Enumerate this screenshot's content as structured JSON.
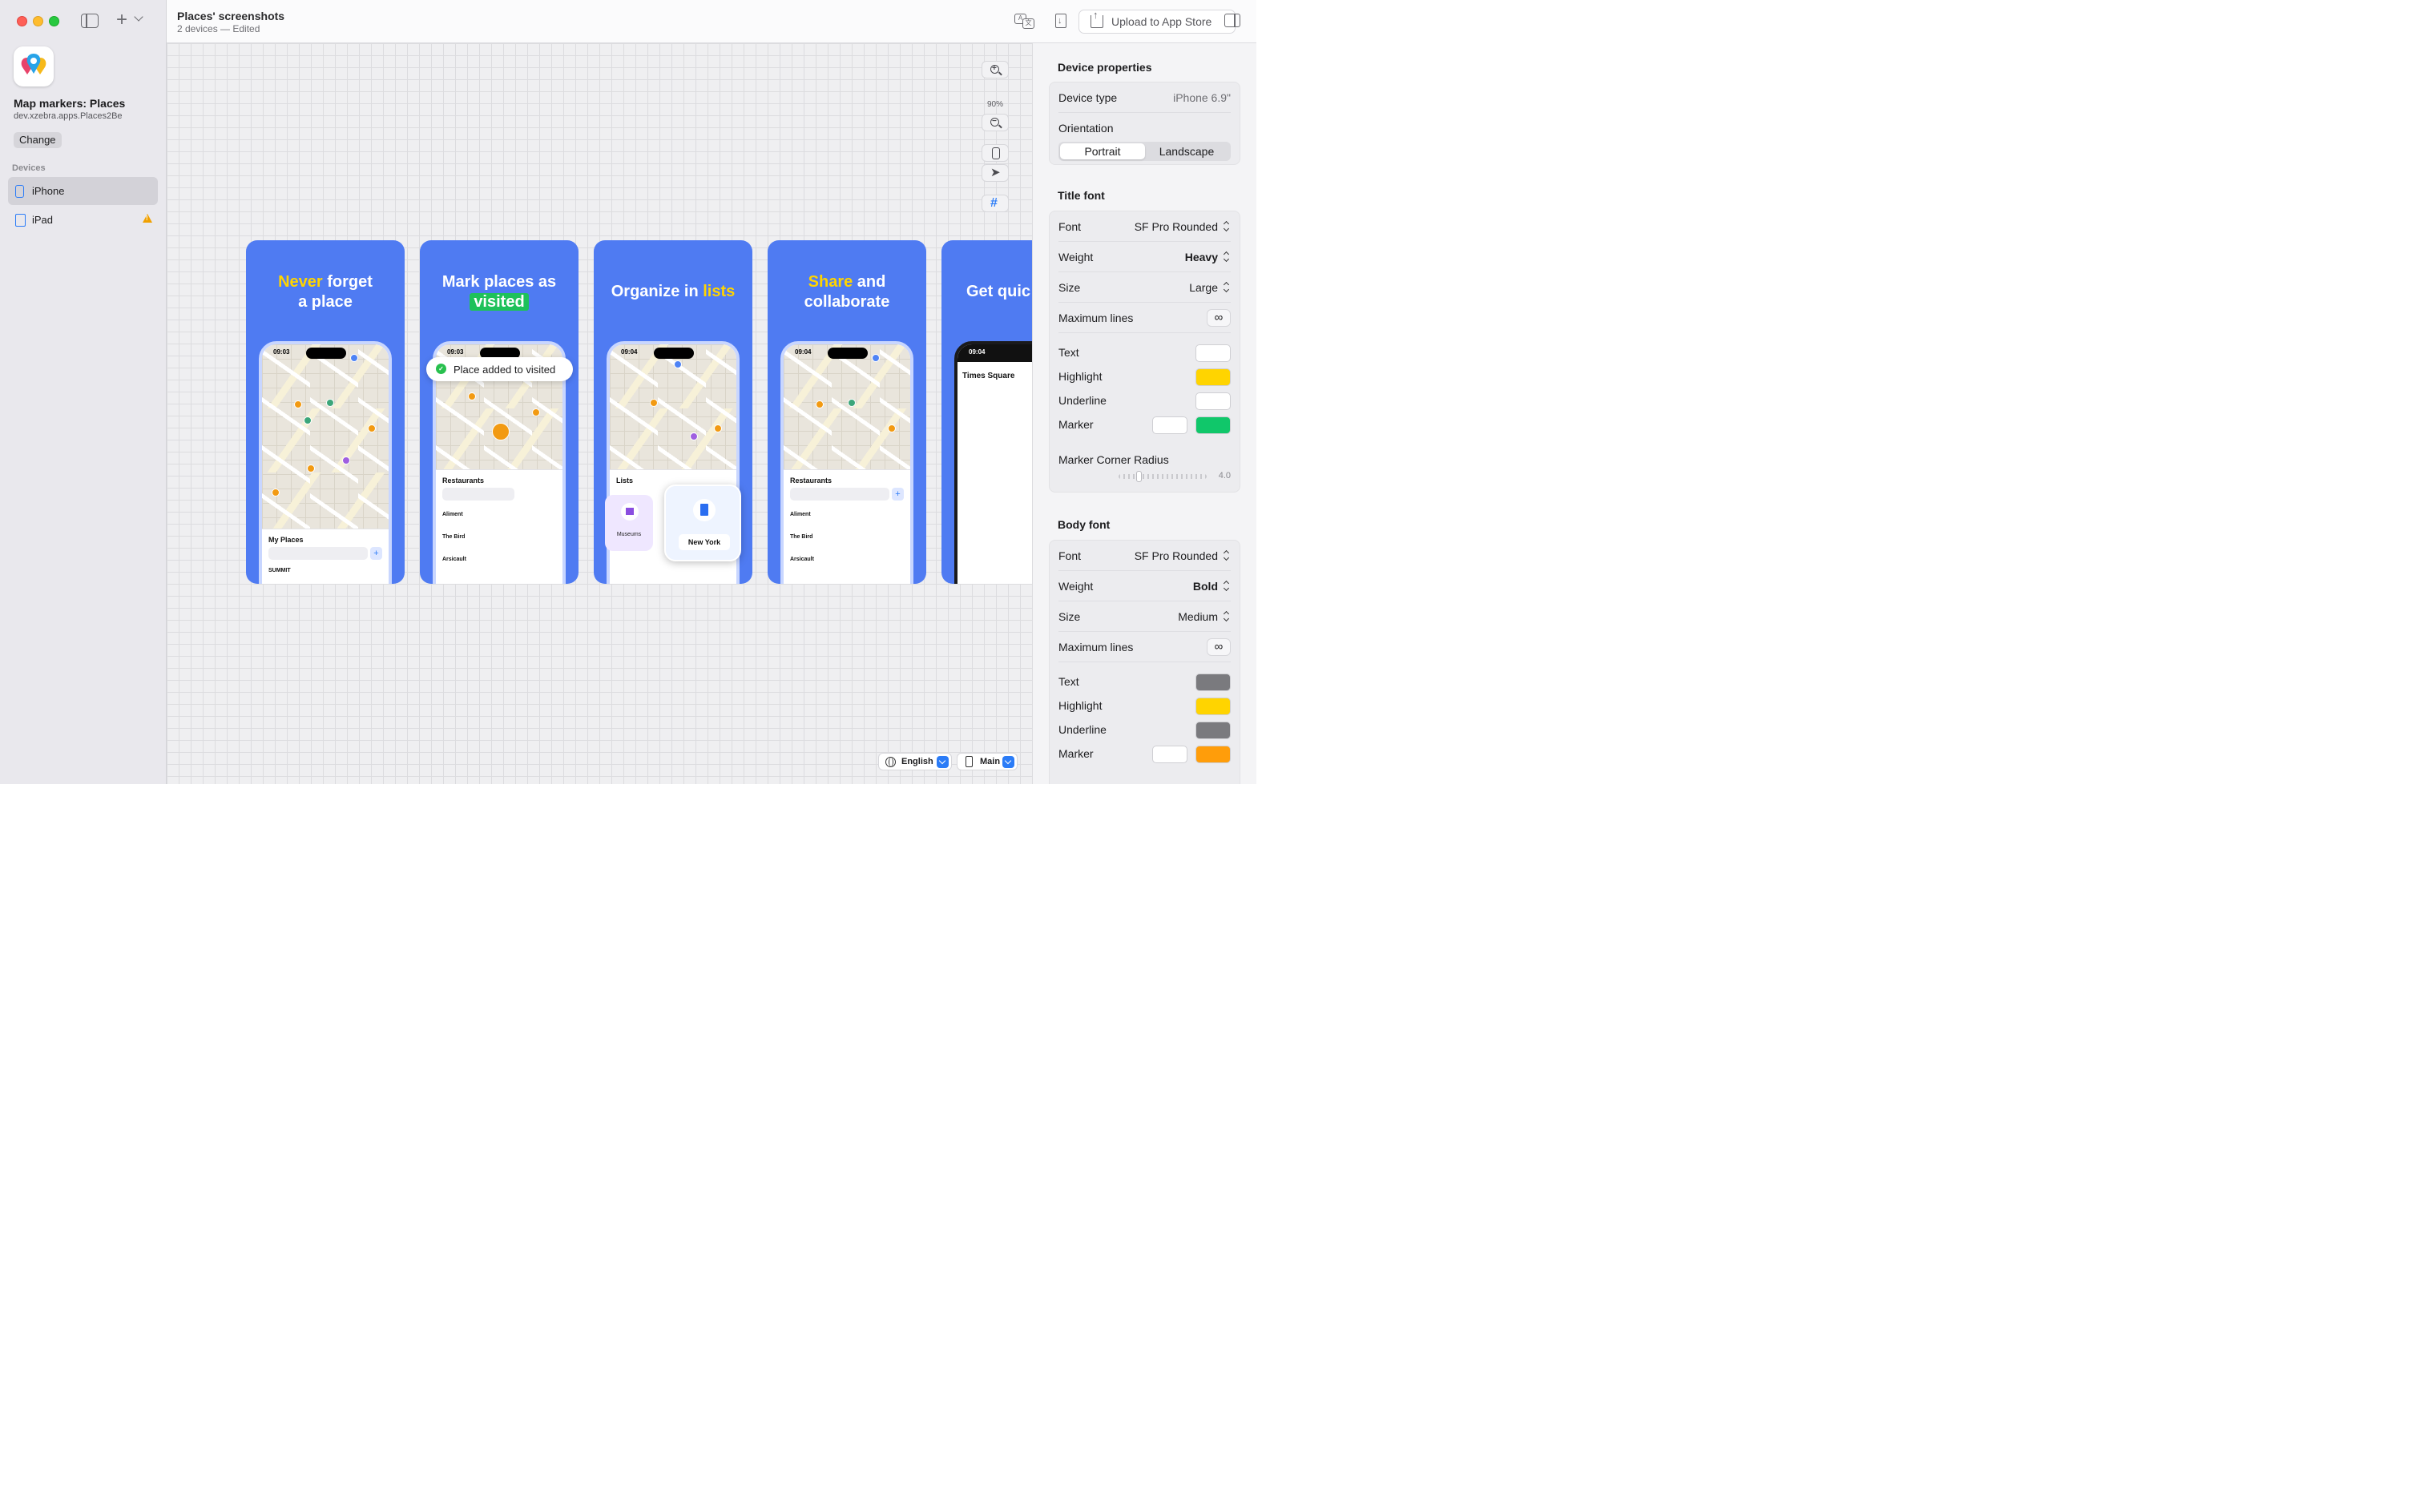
{
  "sidebar": {
    "app_name": "Map markers: Places",
    "bundle_id": "dev.xzebra.apps.Places2Be",
    "change_label": "Change",
    "devices_header": "Devices",
    "devices": [
      {
        "label": "iPhone",
        "selected": true,
        "warning": false
      },
      {
        "label": "iPad",
        "selected": false,
        "warning": true
      }
    ]
  },
  "toolbar": {
    "title": "Places' screenshots",
    "subtitle": "2 devices — Edited",
    "upload_label": "Upload to App Store"
  },
  "canvas": {
    "zoom_level": "90%",
    "language": "English",
    "variant": "Main",
    "cards": [
      {
        "title_parts": [
          "Never",
          " forget",
          "a place"
        ],
        "phone_time": "09:03",
        "sheet_title": "My Places",
        "rows": [
          "SUMMIT"
        ]
      },
      {
        "title_parts": [
          "Mark places as",
          "visited"
        ],
        "phone_time": "09:03",
        "sheet_title": "Restaurants",
        "toast": "Place added to visited",
        "rows": [
          "Aliment",
          "The Bird",
          "Arsicault"
        ]
      },
      {
        "title_parts": [
          "Organize in ",
          "lists"
        ],
        "phone_time": "09:04",
        "sheet_title": "Lists",
        "list_tile": "Museums",
        "popup": "New York"
      },
      {
        "title_parts": [
          "Share",
          " and",
          "collaborate"
        ],
        "phone_time": "09:04",
        "sheet_title": "Restaurants",
        "rows": [
          "Aliment",
          "The Bird",
          "Arsicault"
        ]
      },
      {
        "title_parts": [
          "Get quic"
        ],
        "phone_time": "09:04",
        "sheet_title": "Times Square"
      }
    ]
  },
  "inspector": {
    "device_properties": {
      "header": "Device properties",
      "device_type_label": "Device type",
      "device_type_value": "iPhone 6.9\"",
      "orientation_label": "Orientation",
      "orientation_options": [
        "Portrait",
        "Landscape"
      ],
      "orientation_selected": "Portrait"
    },
    "title_font": {
      "header": "Title font",
      "font_label": "Font",
      "font_value": "SF Pro Rounded",
      "weight_label": "Weight",
      "weight_value": "Heavy",
      "size_label": "Size",
      "size_value": "Large",
      "max_lines_label": "Maximum lines",
      "max_lines_value": "∞",
      "text_label": "Text",
      "text_color": "#ffffff",
      "highlight_label": "Highlight",
      "highlight_color": "#ffd400",
      "underline_label": "Underline",
      "underline_color": "#ffffff",
      "marker_label": "Marker",
      "marker_color_1": "#ffffff",
      "marker_color_2": "#10c76a",
      "corner_radius_label": "Marker Corner Radius",
      "corner_radius_value": "4.0"
    },
    "body_font": {
      "header": "Body font",
      "font_label": "Font",
      "font_value": "SF Pro Rounded",
      "weight_label": "Weight",
      "weight_value": "Bold",
      "size_label": "Size",
      "size_value": "Medium",
      "max_lines_label": "Maximum lines",
      "max_lines_value": "∞",
      "text_label": "Text",
      "text_color": "#7a7a7e",
      "highlight_label": "Highlight",
      "highlight_color": "#ffd400",
      "underline_label": "Underline",
      "underline_color": "#7a7a7e",
      "marker_label": "Marker",
      "marker_color_1": "#ffffff",
      "marker_color_2": "#ff9d0a"
    }
  },
  "colors": {
    "accent": "#2b7cf7",
    "card_background": "#4f7bf2",
    "title_highlight": "#ffd400",
    "visited_badge": "#1ec15a"
  }
}
